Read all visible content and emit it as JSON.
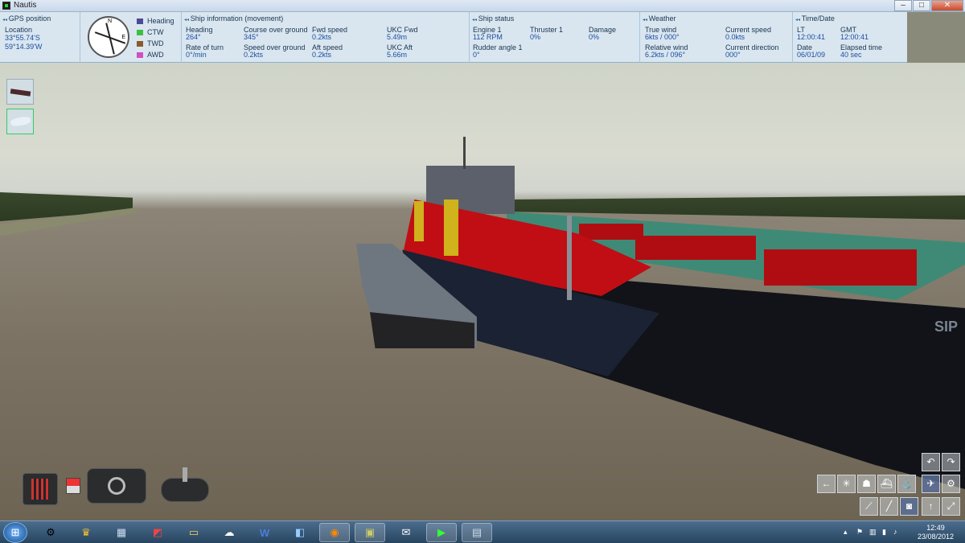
{
  "window": {
    "title": "Nautis",
    "minimize": "–",
    "maximize": "□",
    "close": "✕"
  },
  "gps": {
    "title": "GPS position",
    "location_label": "Location",
    "lat": "33°55.74'S",
    "lon": "59°14.39'W"
  },
  "compass": {
    "n": "N",
    "e": "E",
    "legend": [
      {
        "label": "Heading",
        "color": "#4a4a9a"
      },
      {
        "label": "CTW",
        "color": "#3fbf3f"
      },
      {
        "label": "TWD",
        "color": "#8a5a2a"
      },
      {
        "label": "AWD",
        "color": "#d050c0"
      }
    ]
  },
  "ship_info": {
    "title": "Ship information (movement)",
    "heading_label": "Heading",
    "heading": "264°",
    "cog_label": "Course over ground",
    "cog": "345°",
    "fwd_speed_label": "Fwd speed",
    "fwd_speed": "0.2kts",
    "ukc_fwd_label": "UKC Fwd",
    "ukc_fwd": "5.49m",
    "rot_label": "Rate of turn",
    "rot": "0°/min",
    "sog_label": "Speed over ground",
    "sog": "0.2kts",
    "aft_speed_label": "Aft speed",
    "aft_speed": "0.2kts",
    "ukc_aft_label": "UKC Aft",
    "ukc_aft": "5.66m"
  },
  "ship_status": {
    "title": "Ship status",
    "engine_label": "Engine 1",
    "engine": "112 RPM",
    "thruster_label": "Thruster 1",
    "thruster": "0%",
    "damage_label": "Damage",
    "damage": "0%",
    "rudder_label": "Rudder angle 1",
    "rudder": "0°"
  },
  "weather": {
    "title": "Weather",
    "true_wind_label": "True wind",
    "true_wind": "6kts / 000°",
    "current_speed_label": "Current speed",
    "current_speed": "0.0kts",
    "rel_wind_label": "Relative wind",
    "rel_wind": "6.2kts / 096°",
    "current_dir_label": "Current direction",
    "current_dir": "000°"
  },
  "time": {
    "title": "Time/Date",
    "lt_label": "LT",
    "lt": "12:00:41",
    "gmt_label": "GMT",
    "gmt": "12:00:41",
    "date_label": "Date",
    "date": "06/01/09",
    "elapsed_label": "Elapsed time",
    "elapsed": "40 sec"
  },
  "hull_text": "SIP",
  "taskbar": {
    "start": "⊞",
    "apps": [
      {
        "name": "settings",
        "glyph": "⚙"
      },
      {
        "name": "game",
        "glyph": "♛"
      },
      {
        "name": "calculator",
        "glyph": "▦"
      },
      {
        "name": "presentation",
        "glyph": "◩"
      },
      {
        "name": "explorer",
        "glyph": "▭"
      },
      {
        "name": "weather",
        "glyph": "☁"
      },
      {
        "name": "word",
        "glyph": "W"
      },
      {
        "name": "notes",
        "glyph": "◧"
      },
      {
        "name": "firefox",
        "glyph": "◉"
      },
      {
        "name": "chat",
        "glyph": "▣"
      },
      {
        "name": "thunderbird",
        "glyph": "✉"
      },
      {
        "name": "nautis",
        "glyph": "▶"
      },
      {
        "name": "monitor",
        "glyph": "▤"
      }
    ],
    "clock_time": "12:49",
    "clock_date": "23/08/2012"
  }
}
